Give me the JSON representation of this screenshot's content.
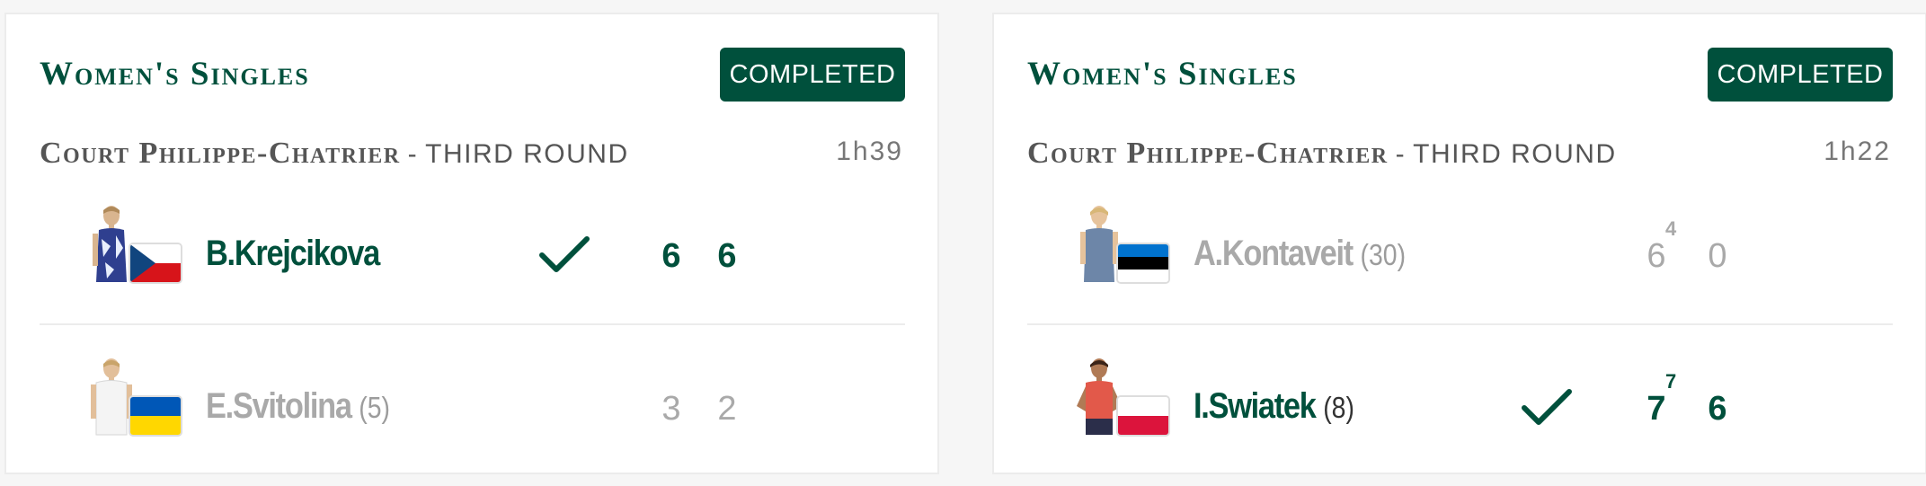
{
  "colors": {
    "brand_green": "#00503c",
    "muted": "#a9a9a9",
    "card_bg": "#ffffff",
    "page_bg": "#f6f6f6"
  },
  "matches": [
    {
      "event": "Women's Singles",
      "status": "COMPLETED",
      "court": "Court Philippe-Chatrier",
      "separator": "-",
      "round": "THIRD ROUND",
      "duration": "1h39",
      "players": [
        {
          "name": "B.Krejcikova",
          "seed": "",
          "flag": "czech-republic-flag",
          "winner": true,
          "sets": [
            "6",
            "6"
          ],
          "tiebreaks": [
            "",
            ""
          ]
        },
        {
          "name": "E.Svitolina",
          "seed": "(5)",
          "flag": "ukraine-flag",
          "winner": false,
          "sets": [
            "3",
            "2"
          ],
          "tiebreaks": [
            "",
            ""
          ]
        }
      ]
    },
    {
      "event": "Women's Singles",
      "status": "COMPLETED",
      "court": "Court Philippe-Chatrier",
      "separator": "-",
      "round": "THIRD ROUND",
      "duration": "1h22",
      "players": [
        {
          "name": "A.Kontaveit",
          "seed": "(30)",
          "flag": "estonia-flag",
          "winner": false,
          "sets": [
            "6",
            "0"
          ],
          "tiebreaks": [
            "4",
            ""
          ]
        },
        {
          "name": "I.Swiatek",
          "seed": "(8)",
          "flag": "poland-flag",
          "winner": true,
          "sets": [
            "7",
            "6"
          ],
          "tiebreaks": [
            "7",
            ""
          ]
        }
      ]
    }
  ]
}
